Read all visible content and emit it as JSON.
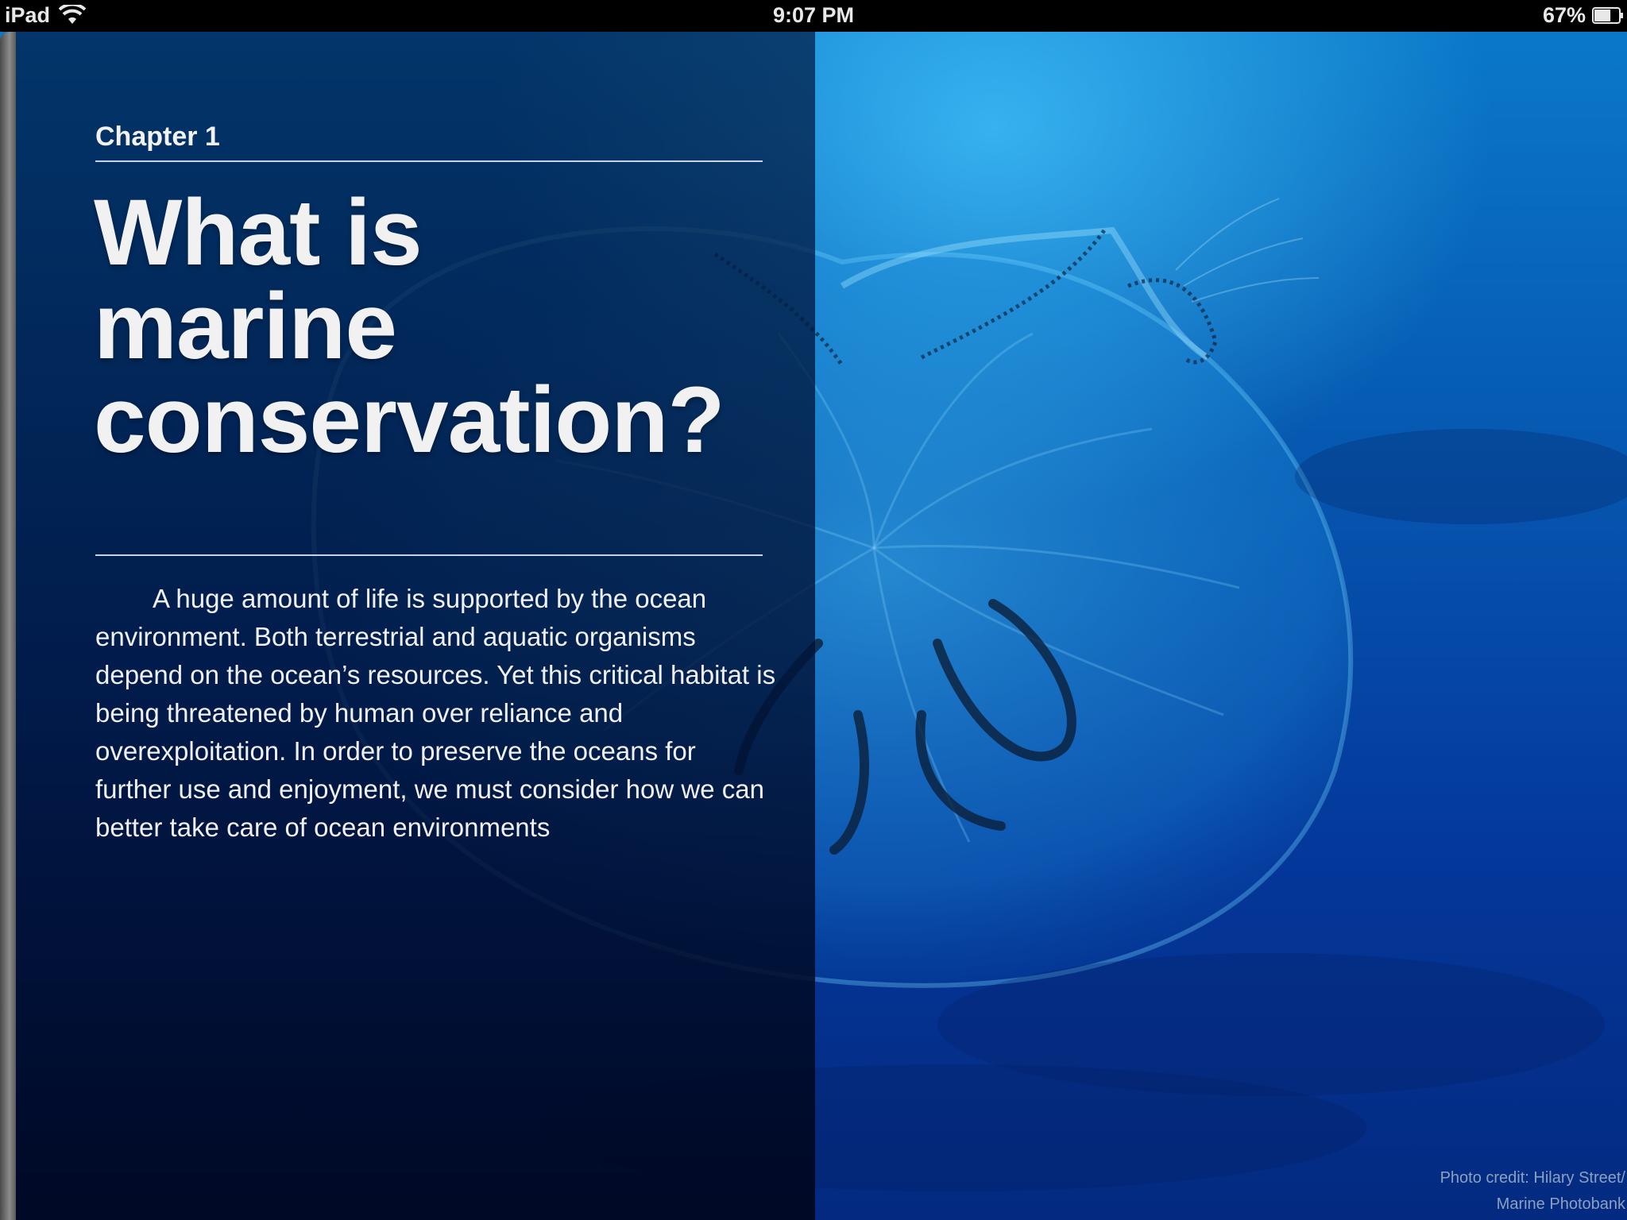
{
  "status_bar": {
    "device": "iPad",
    "time": "9:07 PM",
    "battery_percent": "67%",
    "battery_level": 0.67,
    "icons": [
      "wifi-icon",
      "battery-icon"
    ]
  },
  "page": {
    "chapter_label": "Chapter 1",
    "title_lines": [
      "What is",
      "marine",
      "conservation?"
    ],
    "body": "A huge amount of life is supported by the ocean environment. Both terrestrial and aquatic organisms depend on the ocean’s resources. Yet this critical habitat is being threatened by human over reliance and overexploitation. In order to preserve the oceans for further use and enjoyment, we must consider how we can better take care of ocean environments",
    "photo_credit_lines": [
      "Photo credit: Hilary Street/",
      "Marine Photobank"
    ]
  },
  "colors": {
    "ocean_light": "#46c8ff",
    "ocean_deep": "#032a80",
    "panel_overlay": "#001c46",
    "text": "#f0f0f0"
  }
}
